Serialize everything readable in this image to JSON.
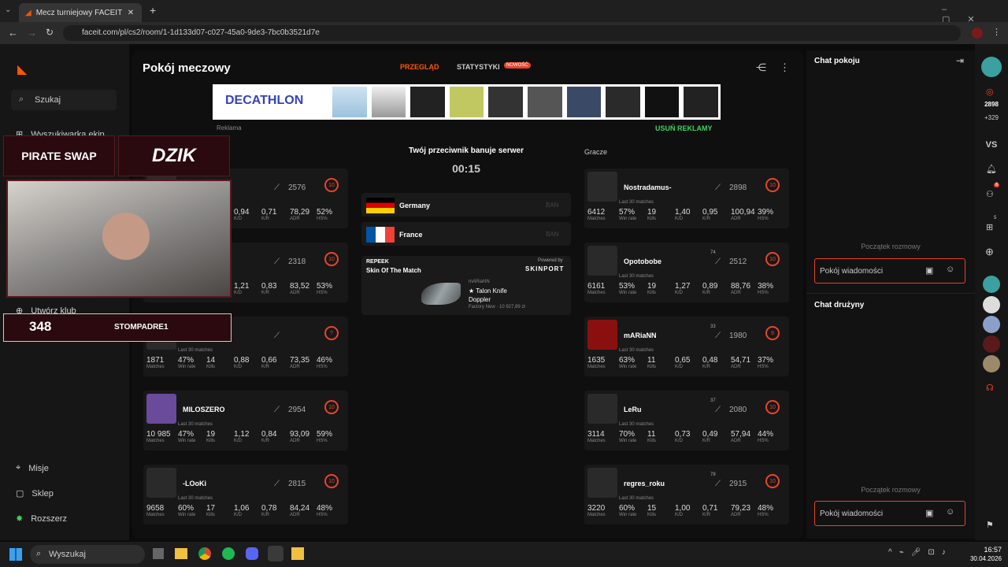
{
  "browser": {
    "tab_title": "Mecz turniejowy FACEIT - FACEIT",
    "url": "faceit.com/pl/cs2/room/1-1d133d07-c027-45a0-9de3-7bc0b3521d7e"
  },
  "nav": {
    "search": "Szukaj",
    "team_finder": "Wyszukiwarka ekip",
    "create_club": "Utwórz klub",
    "missions": "Misje",
    "shop": "Sklep",
    "expand": "Rozszerz"
  },
  "header": {
    "title": "Pokój meczowy",
    "tab_overview": "PRZEGLĄD",
    "tab_stats": "STATYSTYKI",
    "new_badge": "NOWOŚĆ"
  },
  "ad": {
    "brand": "DECATHLON",
    "label": "Reklama",
    "remove": "USUŃ REKLAMY"
  },
  "veto": {
    "heading": "Twój przeciwnik banuje serwer",
    "timer": "00:15",
    "servers": [
      {
        "name": "Germany",
        "action": "BAN"
      },
      {
        "name": "France",
        "action": "BAN"
      }
    ]
  },
  "skin": {
    "brand": "REPEEK",
    "title": "Skin Of The Match",
    "powered": "Powered by",
    "provider": "SKINPORT",
    "owner": "mARiaNN",
    "name": "★ Talon Knife",
    "variant": "Doppler",
    "price": "Factory New · 10 927,89 zł"
  },
  "players_heading": "Gracze",
  "stat_labels": {
    "matches": "Matches",
    "winrate": "Win rate",
    "kills": "Kills",
    "kd": "K/D",
    "kr": "K/R",
    "adr": "ADR",
    "hs": "HS%",
    "last": "Last 30 matches"
  },
  "team_left": [
    {
      "name": "",
      "elo": "2576",
      "lvl": "10",
      "matches": "",
      "winrate": "",
      "kills": "",
      "kd": "0,94",
      "kr": "0,71",
      "adr": "78,29",
      "hs": "52%"
    },
    {
      "name": "",
      "elo": "2318",
      "lvl": "10",
      "matches": "",
      "winrate": "",
      "kills": "",
      "kd": "1,21",
      "kr": "0,83",
      "adr": "83,52",
      "hs": "53%"
    },
    {
      "name": "",
      "elo": "",
      "lvl": "?",
      "matches": "1871",
      "winrate": "47%",
      "kills": "14",
      "kd": "0,88",
      "kr": "0,66",
      "adr": "73,35",
      "hs": "46%"
    },
    {
      "name": "MILOSZERO",
      "elo": "2954",
      "lvl": "10",
      "matches": "10 985",
      "winrate": "47%",
      "kills": "19",
      "kd": "1,12",
      "kr": "0,84",
      "adr": "93,09",
      "hs": "59%"
    },
    {
      "name": "-LOoKi",
      "elo": "2815",
      "lvl": "10",
      "matches": "9658",
      "winrate": "60%",
      "kills": "17",
      "kd": "1,06",
      "kr": "0,78",
      "adr": "84,24",
      "hs": "48%"
    }
  ],
  "team_right": [
    {
      "name": "Nostradamus-",
      "elo": "2898",
      "lvl": "10",
      "matches": "6412",
      "winrate": "57%",
      "kills": "19",
      "kd": "1,40",
      "kr": "0,95",
      "adr": "100,94",
      "hs": "39%",
      "party": ""
    },
    {
      "name": "Opotobobe",
      "elo": "2512",
      "lvl": "10",
      "matches": "6161",
      "winrate": "53%",
      "kills": "19",
      "kd": "1,27",
      "kr": "0,89",
      "adr": "88,76",
      "hs": "38%",
      "party": "74"
    },
    {
      "name": "mARiaNN",
      "elo": "1980",
      "lvl": "9",
      "matches": "1635",
      "winrate": "63%",
      "kills": "11",
      "kd": "0,65",
      "kr": "0,48",
      "adr": "54,71",
      "hs": "37%",
      "party": "33"
    },
    {
      "name": "LeRu",
      "elo": "2080",
      "lvl": "10",
      "matches": "3114",
      "winrate": "70%",
      "kills": "11",
      "kd": "0,73",
      "kr": "0,49",
      "adr": "57,94",
      "hs": "44%",
      "party": "37"
    },
    {
      "name": "regres_roku",
      "elo": "2915",
      "lvl": "10",
      "matches": "3220",
      "winrate": "60%",
      "kills": "15",
      "kd": "1,00",
      "kr": "0,71",
      "adr": "79,23",
      "hs": "48%",
      "party": "78"
    }
  ],
  "chat": {
    "room_title": "Chat pokoju",
    "team_title": "Chat drużyny",
    "start": "Początek rozmowy",
    "placeholder": "Pokój wiadomości"
  },
  "rightbar": {
    "elo": "2898",
    "delta": "+329",
    "vs": "VS",
    "notif": "6",
    "friends": "5"
  },
  "overlay": {
    "sponsor1": "PIRATE SWAP",
    "sponsor2": "DZIK",
    "counter": "348",
    "channel": "STOMPADRE1"
  },
  "taskbar": {
    "search": "Wyszukaj",
    "time": "16:57",
    "date": "30.04.2026"
  }
}
